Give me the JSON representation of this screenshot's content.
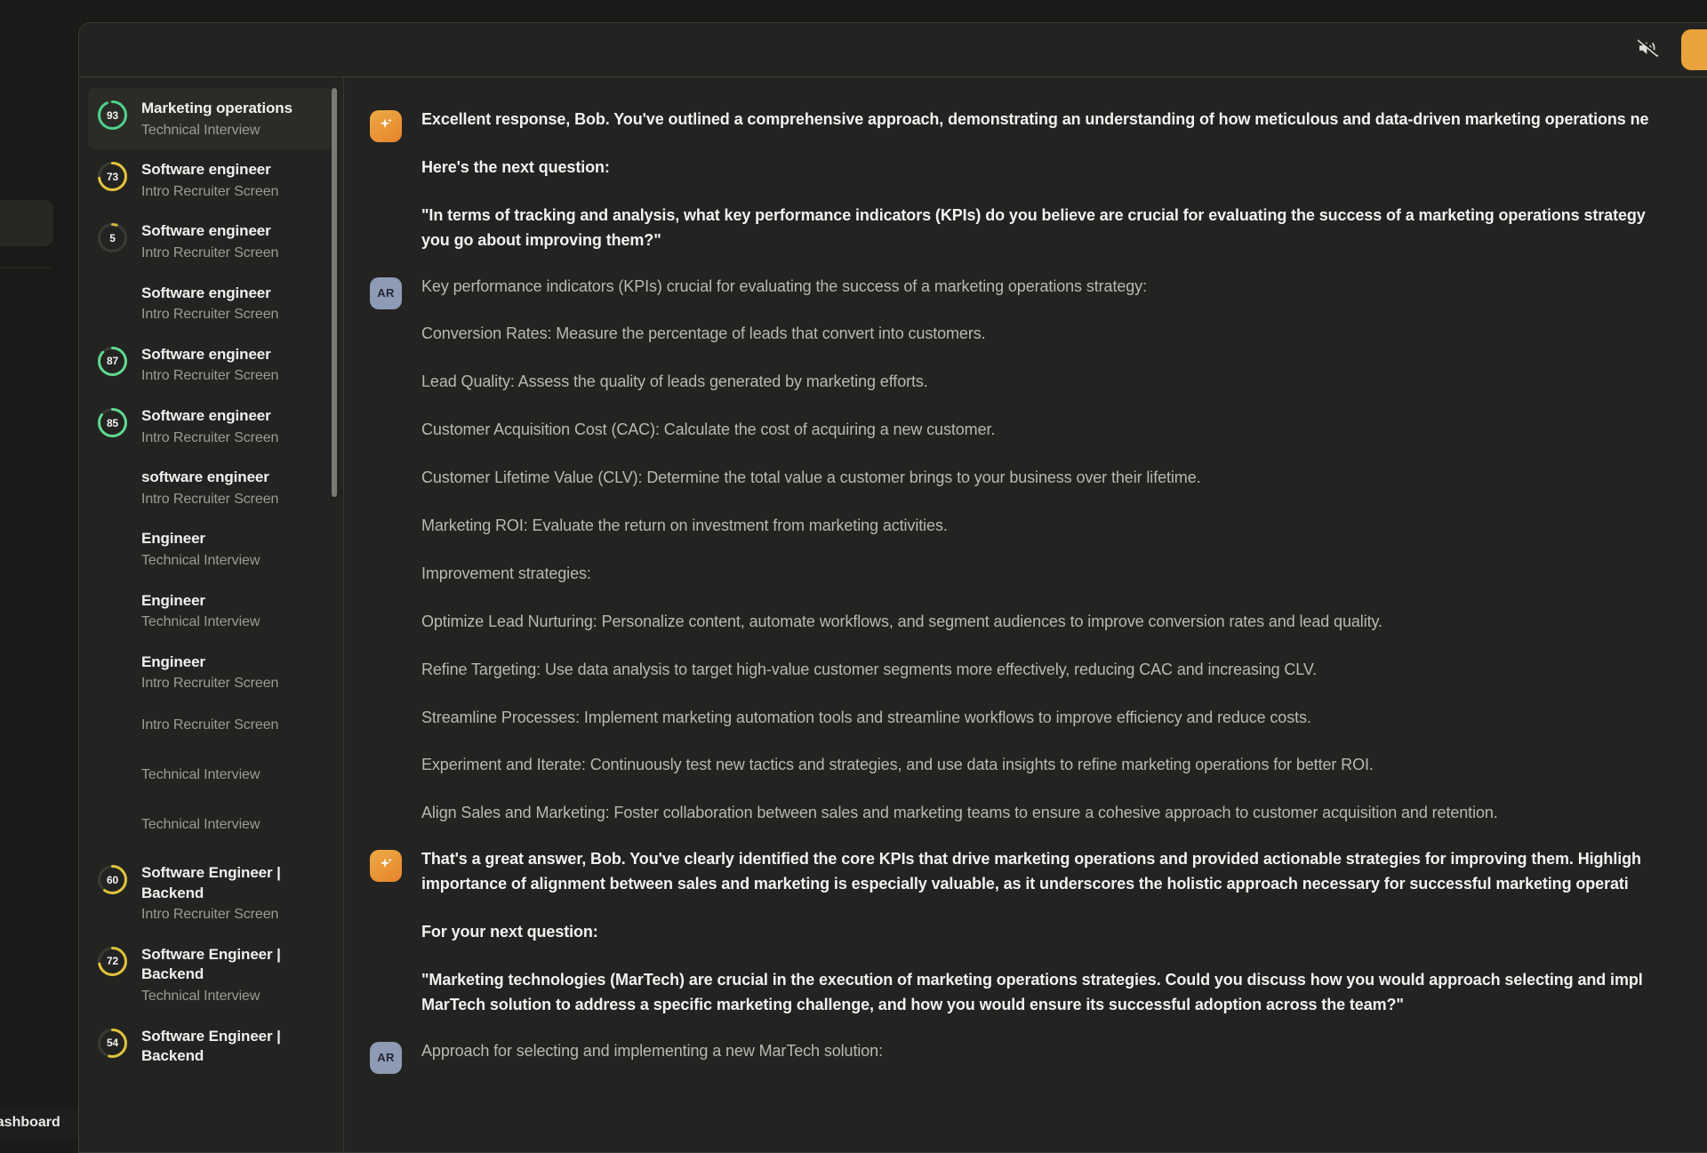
{
  "backdrop": {
    "status_label": "dashboard"
  },
  "topbar": {
    "mute_icon": "speaker-muted-icon",
    "add_icon": "plus-circle-icon",
    "add_label": ""
  },
  "sidebar": {
    "sessions": [
      {
        "score": "93",
        "score_color": "#4fd18b",
        "title": "Marketing operations",
        "subtitle": "Technical Interview",
        "active": true
      },
      {
        "score": "73",
        "score_color": "#e8c33d",
        "title": "Software engineer",
        "subtitle": "Intro Recruiter Screen",
        "active": false
      },
      {
        "score": "5",
        "score_color": "#d6b43a",
        "title": "Software engineer",
        "subtitle": "Intro Recruiter Screen",
        "active": false
      },
      {
        "score": "",
        "score_color": "",
        "title": "Software engineer",
        "subtitle": "Intro Recruiter Screen",
        "active": false
      },
      {
        "score": "87",
        "score_color": "#5fd98f",
        "title": "Software engineer",
        "subtitle": "Intro Recruiter Screen",
        "active": false
      },
      {
        "score": "85",
        "score_color": "#5fd98f",
        "title": "Software engineer",
        "subtitle": "Intro Recruiter Screen",
        "active": false
      },
      {
        "score": "",
        "score_color": "",
        "title": "software engineer",
        "subtitle": "Intro Recruiter Screen",
        "active": false
      },
      {
        "score": "",
        "score_color": "",
        "title": "Engineer",
        "subtitle": "Technical Interview",
        "active": false
      },
      {
        "score": "",
        "score_color": "",
        "title": "Engineer",
        "subtitle": "Technical Interview",
        "active": false
      },
      {
        "score": "",
        "score_color": "",
        "title": "Engineer",
        "subtitle": "Intro Recruiter Screen",
        "active": false
      },
      {
        "score": "",
        "score_color": "",
        "title": "",
        "subtitle": "Intro Recruiter Screen",
        "active": false
      },
      {
        "score": "",
        "score_color": "",
        "title": "",
        "subtitle": "Technical Interview",
        "active": false
      },
      {
        "score": "",
        "score_color": "",
        "title": "",
        "subtitle": "Technical Interview",
        "active": false
      },
      {
        "score": "60",
        "score_color": "#e0c23c",
        "title": "Software Engineer | Backend",
        "subtitle": "Intro Recruiter Screen",
        "active": false
      },
      {
        "score": "72",
        "score_color": "#e0c23c",
        "title": "Software Engineer | Backend",
        "subtitle": "Technical Interview",
        "active": false
      },
      {
        "score": "54",
        "score_color": "#e0c23c",
        "title": "Software Engineer | Backend",
        "subtitle": "",
        "active": false
      }
    ]
  },
  "chat": {
    "messages": [
      {
        "role": "ai",
        "avatar_icon": "sparkle-icon",
        "initials": "",
        "paragraphs": [
          "Excellent response, Bob. You've outlined a comprehensive approach, demonstrating an understanding of how meticulous and data-driven marketing operations ne",
          "Here's the next question:",
          "\"In terms of tracking and analysis, what key performance indicators (KPIs) do you believe are crucial for evaluating the success of a marketing operations strategy\nyou go about improving them?\""
        ]
      },
      {
        "role": "user",
        "avatar_icon": "",
        "initials": "AR",
        "paragraphs": [
          "Key performance indicators (KPIs) crucial for evaluating the success of a marketing operations strategy:",
          "Conversion Rates: Measure the percentage of leads that convert into customers.",
          "Lead Quality: Assess the quality of leads generated by marketing efforts.",
          "Customer Acquisition Cost (CAC): Calculate the cost of acquiring a new customer.",
          "Customer Lifetime Value (CLV): Determine the total value a customer brings to your business over their lifetime.",
          "Marketing ROI: Evaluate the return on investment from marketing activities.",
          "Improvement strategies:",
          "Optimize Lead Nurturing: Personalize content, automate workflows, and segment audiences to improve conversion rates and lead quality.",
          "Refine Targeting: Use data analysis to target high-value customer segments more effectively, reducing CAC and increasing CLV.",
          "Streamline Processes: Implement marketing automation tools and streamline workflows to improve efficiency and reduce costs.",
          "Experiment and Iterate: Continuously test new tactics and strategies, and use data insights to refine marketing operations for better ROI.",
          "Align Sales and Marketing: Foster collaboration between sales and marketing teams to ensure a cohesive approach to customer acquisition and retention."
        ]
      },
      {
        "role": "ai",
        "avatar_icon": "sparkle-icon",
        "initials": "",
        "paragraphs": [
          "That's a great answer, Bob. You've clearly identified the core KPIs that drive marketing operations and provided actionable strategies for improving them. Highligh\nimportance of alignment between sales and marketing is especially valuable, as it underscores the holistic approach necessary for successful marketing operati",
          "For your next question:",
          "\"Marketing technologies (MarTech) are crucial in the execution of marketing operations strategies. Could you discuss how you would approach selecting and impl\nMarTech solution to address a specific marketing challenge, and how you would ensure its successful adoption across the team?\""
        ]
      },
      {
        "role": "user",
        "avatar_icon": "",
        "initials": "AR",
        "paragraphs": [
          "Approach for selecting and implementing a new MarTech solution:"
        ]
      }
    ]
  }
}
